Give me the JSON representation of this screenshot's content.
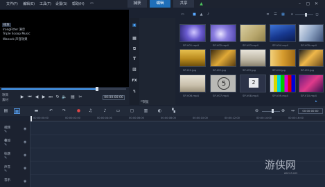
{
  "menubar": {
    "items": [
      "文件(F)",
      "编辑(E)",
      "工具(T)",
      "设置(S)",
      "帮助(H)"
    ],
    "tabs": [
      "捕获",
      "编辑",
      "共享"
    ]
  },
  "preview": {
    "mode_labels": [
      "项目",
      "素材"
    ],
    "timecode": "00:00:00:00"
  },
  "library": {
    "nav_items": [
      "样本",
      "IrongFitter 演示",
      "Triple Scoop Music",
      "Wanock 声音效果"
    ],
    "browse_label": "浏览",
    "thumbnails": [
      {
        "label": "SP-V01.mp4"
      },
      {
        "label": "SP-V02.mp4"
      },
      {
        "label": "SP-V03.mp4"
      },
      {
        "label": "SP-V04.mp4"
      },
      {
        "label": "SP-V05.mp4"
      },
      {
        "label": "SP-I01.jpg"
      },
      {
        "label": "SP-I02.jpg"
      },
      {
        "label": "SP-I03.jpg"
      },
      {
        "label": "SP-I04.jpg"
      },
      {
        "label": "SP-I05.jpg"
      },
      {
        "label": "SP-V06.mp4"
      },
      {
        "label": "SP-V07.mp4"
      },
      {
        "label": "SP-V08.mp4"
      },
      {
        "label": "SP-V09.mp4"
      },
      {
        "label": "SP-V10.mp4"
      }
    ],
    "countdown_digits": [
      "5",
      "2"
    ]
  },
  "timeline": {
    "ruler_ticks": [
      "00:00:00:00",
      "00:00:02:00",
      "00:00:04:00",
      "00:00:06:00",
      "00:00:08:00",
      "00:00:10:00",
      "00:00:12:00",
      "00:00:14:00",
      "00:00:16:00"
    ],
    "tracks": [
      "视频",
      "叠加",
      "标题",
      "声音",
      "音乐"
    ]
  },
  "watermark": {
    "text": "游侠网",
    "url": "ali213.net"
  }
}
